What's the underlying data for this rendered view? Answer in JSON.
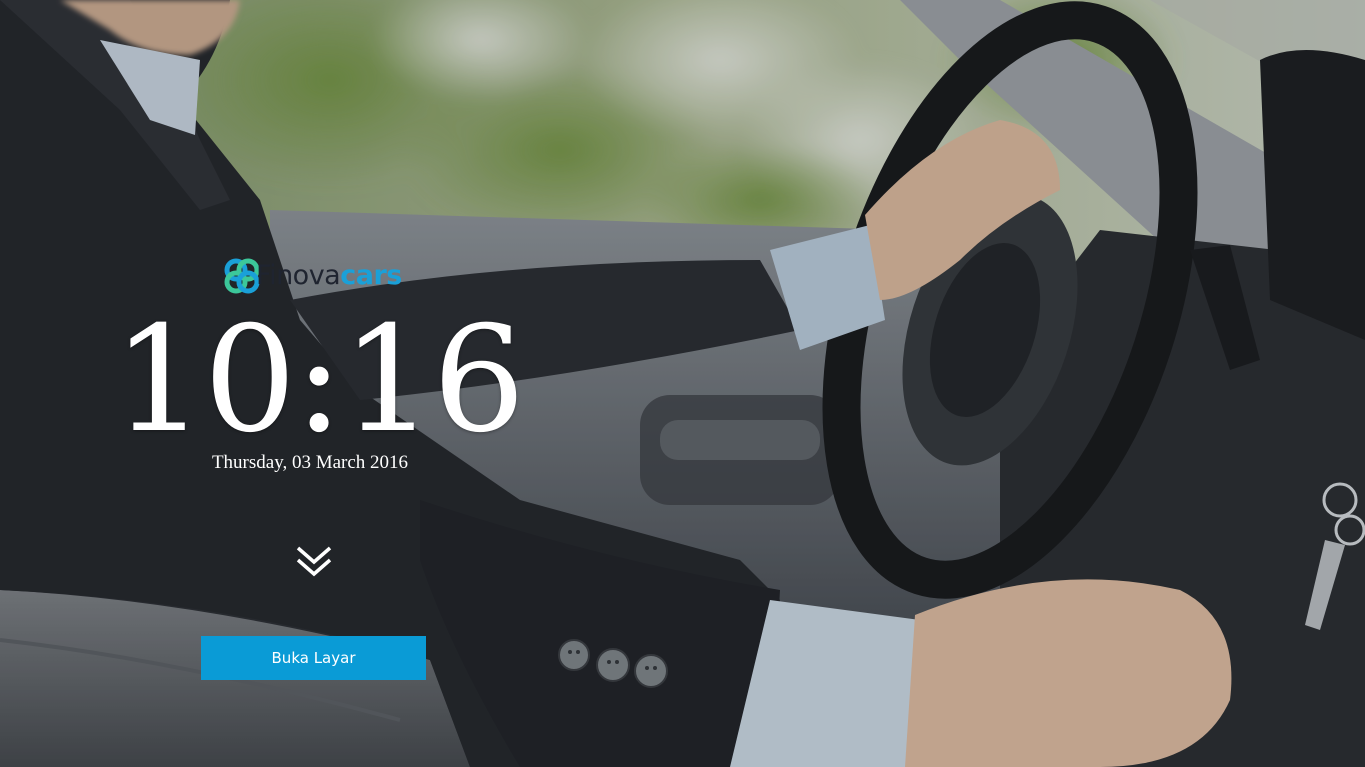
{
  "logo": {
    "text_part1": "Finova",
    "text_part2": "cars",
    "icon": "finovacars-logo-icon",
    "colors": {
      "dark": "#1f2430",
      "accent": "#1aa0d8",
      "green": "#3cc79a"
    }
  },
  "clock": {
    "time": "10:16",
    "date": "Thursday, 03 March 2016"
  },
  "scroll_hint": {
    "icon": "double-chevron-down-icon"
  },
  "unlock_button": {
    "label": "Buka Layar",
    "color": "#0a9bd6"
  }
}
